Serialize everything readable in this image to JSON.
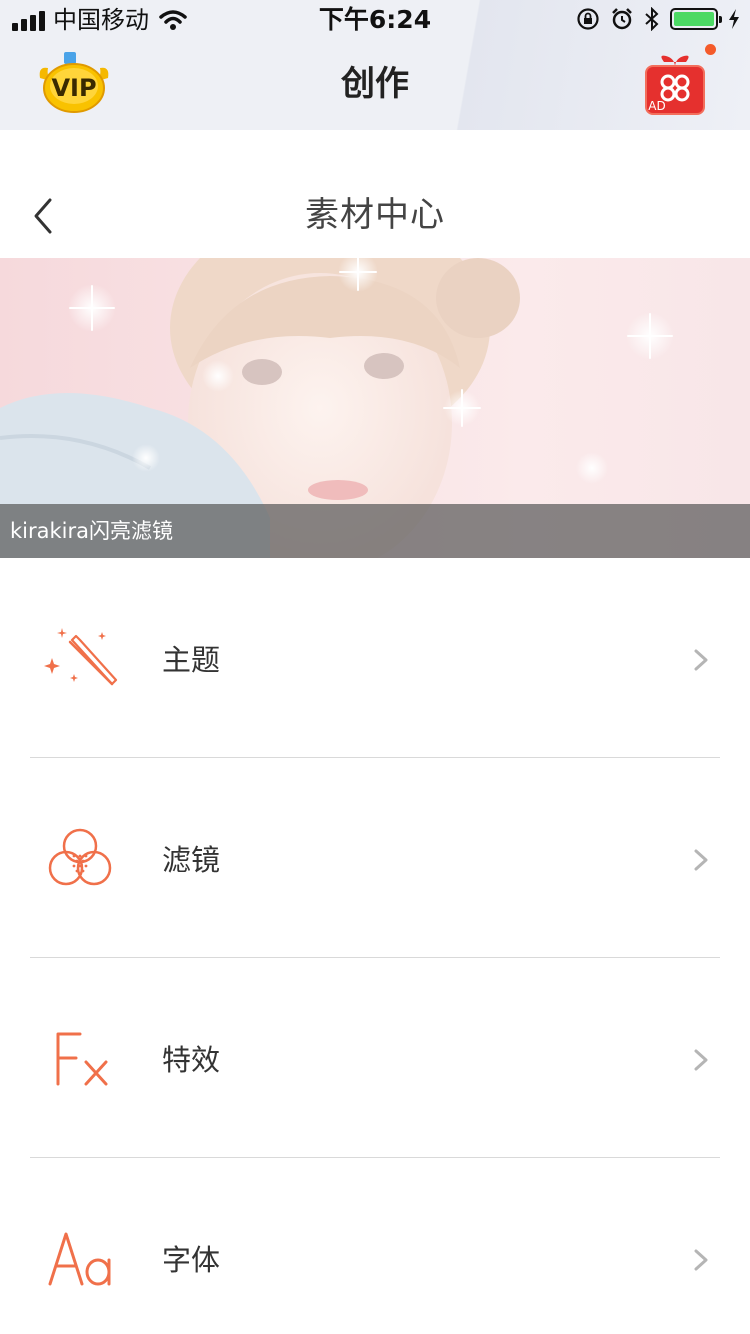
{
  "status_bar": {
    "carrier": "中国移动",
    "time": "下午6:24"
  },
  "app_header": {
    "title": "创作",
    "vip_text": "VIP",
    "gift_text": "AD"
  },
  "nav": {
    "title": "素材中心"
  },
  "banner": {
    "caption": "kirakira闪亮滤镜"
  },
  "menu": {
    "items": [
      {
        "label": "主题",
        "icon": "magic-wand-icon"
      },
      {
        "label": "滤镜",
        "icon": "filter-icon"
      },
      {
        "label": "特效",
        "icon": "fx-icon"
      },
      {
        "label": "字体",
        "icon": "font-icon"
      }
    ]
  },
  "colors": {
    "accent": "#f0704a",
    "text": "#333333",
    "divider": "#d9d9d9",
    "battery": "#4cd964"
  }
}
